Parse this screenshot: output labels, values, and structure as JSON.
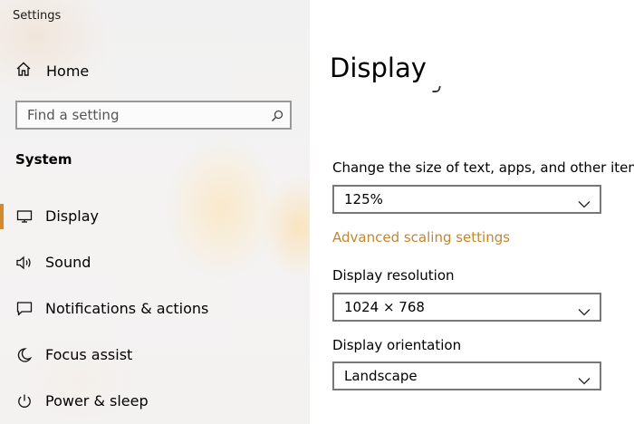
{
  "window": {
    "title": "Settings"
  },
  "sidebar": {
    "home_label": "Home",
    "search": {
      "placeholder": "Find a setting",
      "value": ""
    },
    "section_title": "System",
    "items": [
      {
        "label": "Display",
        "icon": "monitor-icon",
        "selected": true
      },
      {
        "label": "Sound",
        "icon": "speaker-icon",
        "selected": false
      },
      {
        "label": "Notifications & actions",
        "icon": "message-icon",
        "selected": false
      },
      {
        "label": "Focus assist",
        "icon": "moon-icon",
        "selected": false
      },
      {
        "label": "Power & sleep",
        "icon": "power-icon",
        "selected": false
      }
    ],
    "accent_color": "#d18a2c"
  },
  "main": {
    "title": "Display",
    "scale": {
      "label": "Change the size of text, apps, and other items",
      "value": "125%"
    },
    "advanced_link": "Advanced scaling settings",
    "resolution": {
      "label": "Display resolution",
      "value": "1024 × 768"
    },
    "orientation": {
      "label": "Display orientation",
      "value": "Landscape"
    },
    "link_color": "#c4862d"
  }
}
